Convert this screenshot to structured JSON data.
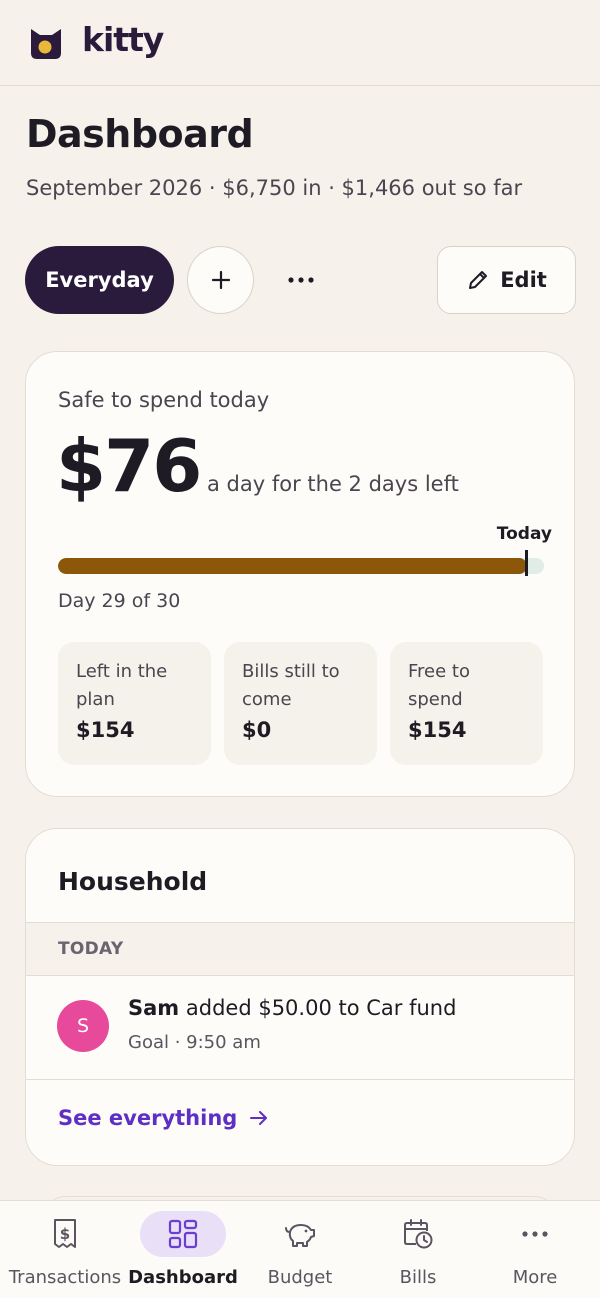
{
  "app": {
    "brand": "kitty",
    "brand_color": "#2a1a3c",
    "accent_color": "#e9b83a",
    "link_color": "#5d2fc4"
  },
  "header": {
    "title": "Dashboard",
    "subtitle": "September 2026 · $6,750 in · $1,466 out so far"
  },
  "toolbar": {
    "active_pill": "Everyday",
    "add_icon": "plus-icon",
    "more_icon": "more-horizontal-icon",
    "edit_label": "Edit",
    "edit_icon": "pencil-icon"
  },
  "safe_to_spend": {
    "label": "Safe to spend today",
    "amount": "$76",
    "description": "a day for the 2 days left",
    "today_label": "Today",
    "day_text": "Day 29 of 30",
    "progress_fraction": 0.966,
    "progress_color": "#8c5708",
    "stats": [
      {
        "label": "Left in the plan",
        "value": "$154"
      },
      {
        "label": "Bills still to come",
        "value": "$0"
      },
      {
        "label": "Free to spend",
        "value": "$154"
      }
    ]
  },
  "household": {
    "title": "Household",
    "group_label": "TODAY",
    "activities": [
      {
        "avatar_initial": "S",
        "avatar_color": "#e74a9b",
        "actor": "Sam",
        "action": "added $50.00 to Car fund",
        "meta": "Goal · 9:50 am"
      }
    ],
    "see_all_label": "See everything",
    "see_all_icon": "arrow-right-icon"
  },
  "nav": {
    "items": [
      {
        "label": "Transactions",
        "icon": "receipt-icon",
        "active": false
      },
      {
        "label": "Dashboard",
        "icon": "dashboard-icon",
        "active": true
      },
      {
        "label": "Budget",
        "icon": "piggy-bank-icon",
        "active": false
      },
      {
        "label": "Bills",
        "icon": "calendar-clock-icon",
        "active": false
      },
      {
        "label": "More",
        "icon": "more-horizontal-icon",
        "active": false
      }
    ]
  }
}
